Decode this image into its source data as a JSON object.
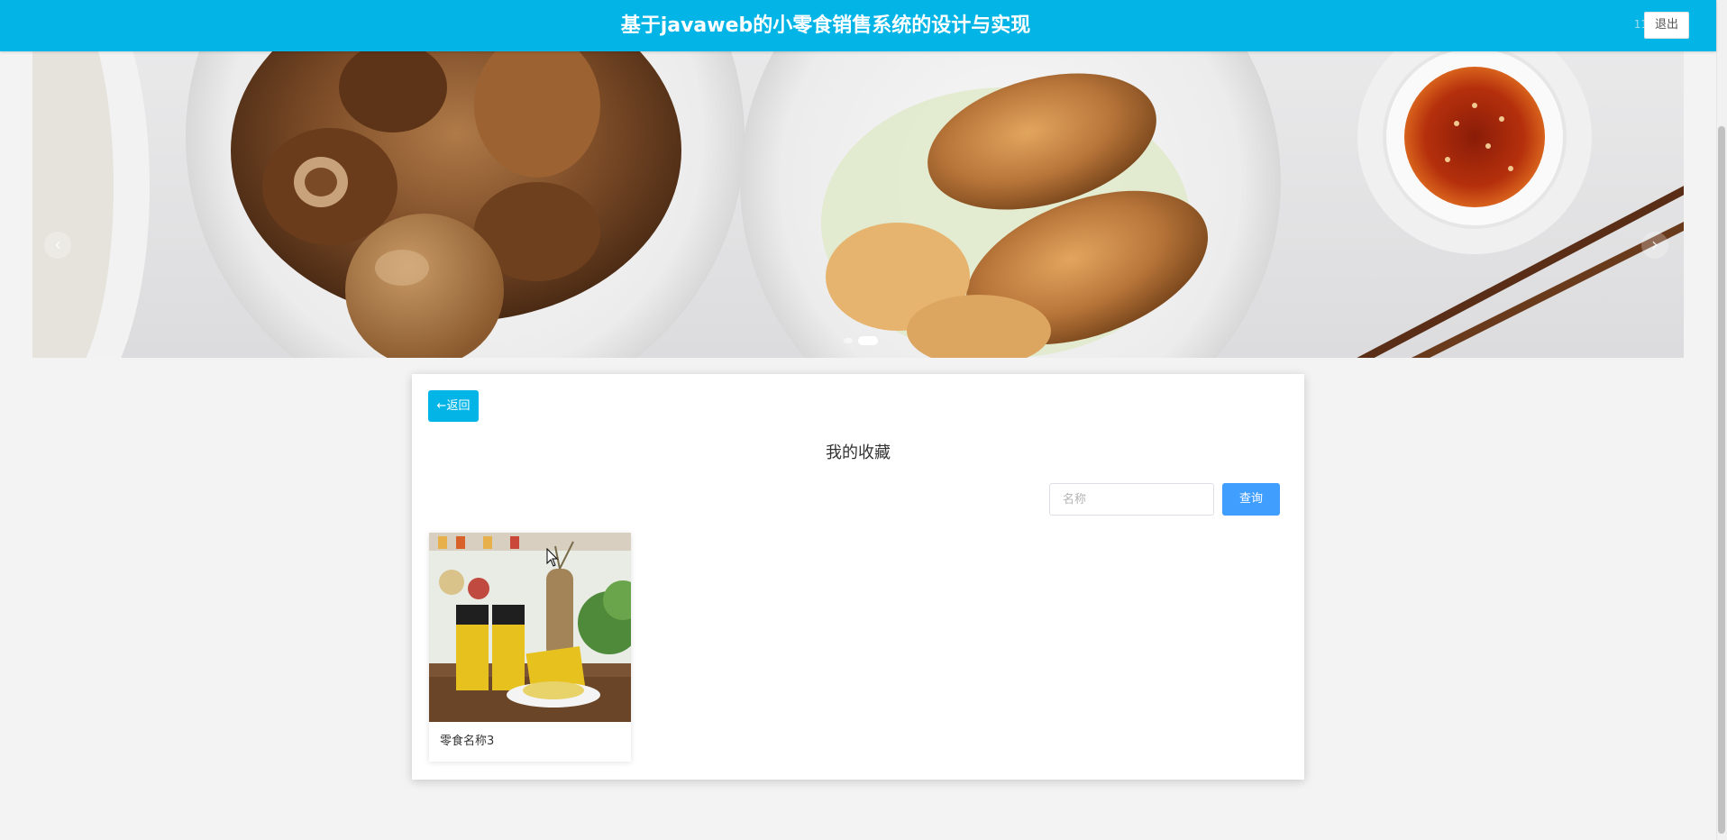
{
  "header": {
    "title": "基于javaweb的小零食销售系统的设计与实现",
    "user_text": "11",
    "logout_label": "退出",
    "background_color": "#02b5e6"
  },
  "banner": {
    "prev_icon": "chevron-left-icon",
    "next_icon": "chevron-right-icon",
    "prev_glyph": "‹",
    "next_glyph": "›",
    "slide_count": 2,
    "active_slide": 2
  },
  "page": {
    "back_label": "←返回",
    "title": "我的收藏",
    "search_placeholder": "名称",
    "search_button": "查询",
    "accent_color": "#409eff"
  },
  "favorites": [
    {
      "name": "零食名称3"
    }
  ]
}
